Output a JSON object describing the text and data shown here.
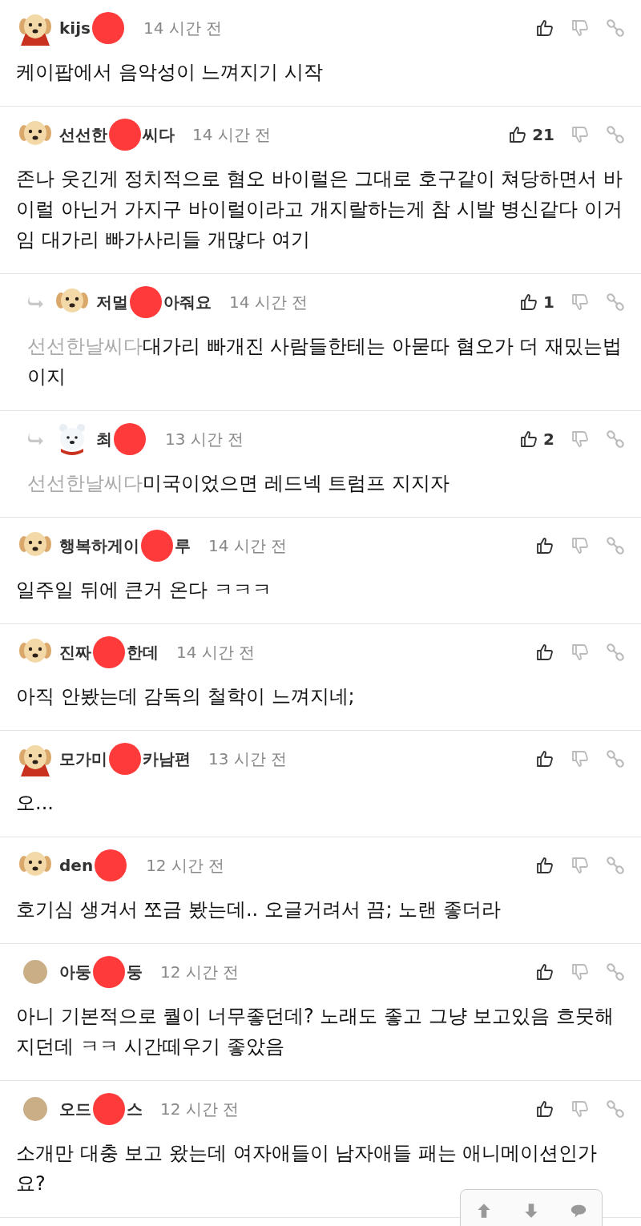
{
  "comments": [
    {
      "kind": "comment",
      "avatar": {
        "kind": "puppy-cape"
      },
      "name_parts": [
        "kijs"
      ],
      "time": "14 시간 전",
      "text": "케이팝에서 음악성이 느껴지기 시작"
    },
    {
      "kind": "comment",
      "avatar": {
        "kind": "puppy"
      },
      "name_parts": [
        "선선한",
        "씨다"
      ],
      "time": "14 시간 전",
      "likes": "21",
      "text": "존나 웃긴게 정치적으로 혐오 바이럴은 그대로 호구같이 쳐당하면서 바이럴 아닌거 가지구 바이럴이라고 개지랄하는게 참 시발 병신같다 이거임 대가리 빠가사리들 개많다 여기"
    },
    {
      "kind": "reply",
      "avatar": {
        "kind": "puppy"
      },
      "name_parts": [
        "저멀",
        "아줘요"
      ],
      "time": "14 시간 전",
      "likes": "1",
      "reply_to": "선선한날씨다",
      "text": "대가리 빠개진 사람들한테는 아묻따 혐오가 더 재밌는법이지"
    },
    {
      "kind": "reply",
      "avatar": {
        "kind": "bear"
      },
      "name_parts": [
        "최"
      ],
      "time": "13 시간 전",
      "likes": "2",
      "reply_to": "선선한날씨다",
      "text": "미국이었으면 레드넥 트럼프 지지자"
    },
    {
      "kind": "comment",
      "avatar": {
        "kind": "puppy"
      },
      "name_parts": [
        "행복하게이",
        "루"
      ],
      "time": "14 시간 전",
      "text": "일주일 뒤에 큰거 온다 ㅋㅋㅋ"
    },
    {
      "kind": "comment",
      "avatar": {
        "kind": "puppy"
      },
      "name_parts": [
        "진짜",
        "한데"
      ],
      "time": "14 시간 전",
      "text": "아직 안봤는데 감독의 철학이 느껴지네;"
    },
    {
      "kind": "comment",
      "avatar": {
        "kind": "puppy-cape"
      },
      "name_parts": [
        "모가미",
        "카남편"
      ],
      "time": "13 시간 전",
      "text": "오..."
    },
    {
      "kind": "comment",
      "avatar": {
        "kind": "puppy"
      },
      "name_parts": [
        "den"
      ],
      "time": "12 시간 전",
      "text": "호기심 생겨서 쪼금 봤는데.. 오글거려서 끔; 노랜 좋더라"
    },
    {
      "kind": "comment",
      "avatar": {
        "kind": "ball"
      },
      "name_parts": [
        "아둥",
        "둥"
      ],
      "time": "12 시간 전",
      "text": "아니 기본적으로 퀄이 너무좋던데? 노래도 좋고 그냥 보고있음 흐뭇해지던데 ㅋㅋ 시간떼우기 좋았음"
    },
    {
      "kind": "comment",
      "avatar": {
        "kind": "ball"
      },
      "name_parts": [
        "오드",
        "스"
      ],
      "time": "12 시간 전",
      "text": "소개만 대충 보고 왔는데 여자애들이 남자애들 패는 애니메이션인가요?"
    }
  ]
}
